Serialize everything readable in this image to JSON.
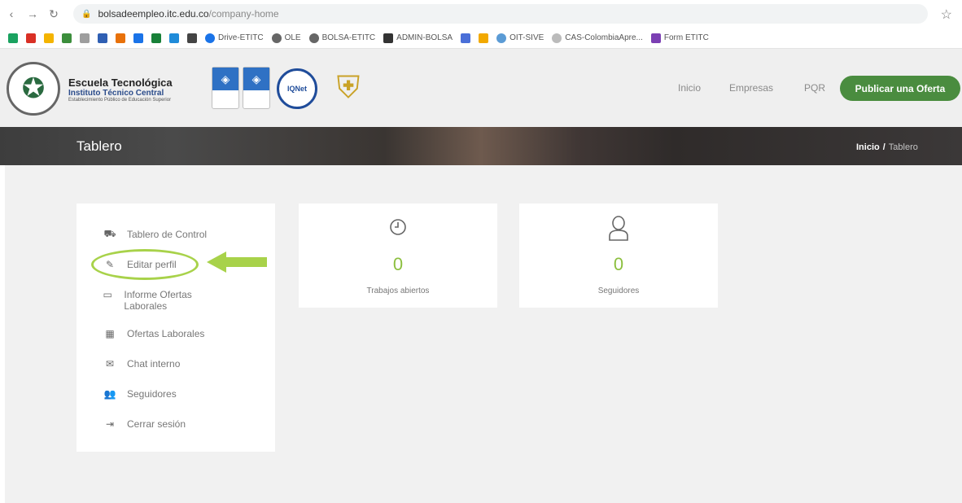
{
  "browser": {
    "url_host": "bolsadeempleo.itc.edu.co",
    "url_path": "/company-home",
    "bookmarks": [
      "Drive-ETITC",
      "OLE",
      "BOLSA-ETITC",
      "ADMIN-BOLSA",
      "OIT-SIVE",
      "CAS-ColombiaApre...",
      "Form ETITC"
    ]
  },
  "header": {
    "logo_line1": "Escuela Tecnológica",
    "logo_line2": "Instituto Técnico Central",
    "logo_line3": "Establecimiento Público de Educación Superior",
    "round_badge": "IQNet",
    "nav": [
      "Inicio",
      "Empresas",
      "PQR"
    ],
    "cta": "Publicar una Oferta"
  },
  "banner": {
    "title": "Tablero",
    "breadcrumb_home": "Inicio",
    "breadcrumb_sep": "/",
    "breadcrumb_current": "Tablero"
  },
  "sidebar": {
    "items": [
      {
        "label": "Tablero de Control",
        "icon": "dashboard-icon"
      },
      {
        "label": "Editar perfil",
        "icon": "pencil-icon"
      },
      {
        "label": "Informe Ofertas Laborales",
        "icon": "monitor-icon"
      },
      {
        "label": "Ofertas Laborales",
        "icon": "film-icon"
      },
      {
        "label": "Chat interno",
        "icon": "envelope-icon"
      },
      {
        "label": "Seguidores",
        "icon": "users-icon"
      },
      {
        "label": "Cerrar sesión",
        "icon": "sign-out-icon"
      }
    ]
  },
  "cards": [
    {
      "value": "0",
      "label": "Trabajos abiertos",
      "icon": "clock-icon"
    },
    {
      "value": "0",
      "label": "Seguidores",
      "icon": "user-icon"
    }
  ],
  "colors": {
    "accent_green": "#4a8c3f",
    "value_green": "#8cbf3f",
    "highlight": "#a8d24a"
  }
}
